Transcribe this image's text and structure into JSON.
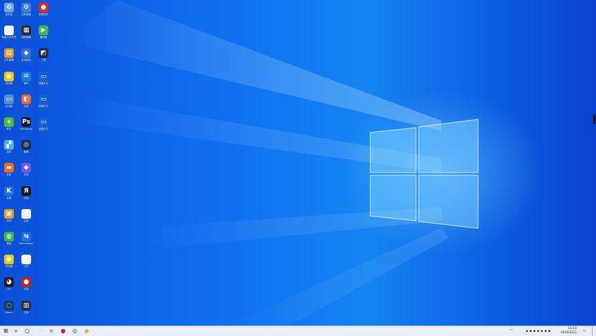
{
  "desktop": {
    "icons": [
      {
        "name": "recycle-bin-icon",
        "label": "回收站",
        "col": 0,
        "row": 0,
        "color": "#6aa8e8",
        "glyph": "♻"
      },
      {
        "name": "control-panel-icon",
        "label": "控制面板",
        "col": 1,
        "row": 0,
        "color": "#3d7fd6",
        "glyph": "⚙"
      },
      {
        "name": "record-app-icon",
        "label": "录屏软件",
        "col": 2,
        "row": 0,
        "color": "#d92a2a",
        "glyph": "●"
      },
      {
        "name": "document-icon",
        "label": "新建文本文档",
        "col": 0,
        "row": 1,
        "color": "#f4f4f4",
        "glyph": ""
      },
      {
        "name": "video-editor-icon",
        "label": "视频编辑",
        "col": 1,
        "row": 1,
        "color": "#2a2a2a",
        "glyph": "▦"
      },
      {
        "name": "player-icon",
        "label": "播放器",
        "col": 2,
        "row": 1,
        "color": "#3cb84a",
        "glyph": "▶"
      },
      {
        "name": "folder-app-icon",
        "label": "文件管理",
        "col": 0,
        "row": 2,
        "color": "#d99a2a",
        "glyph": "▤"
      },
      {
        "name": "store-icon",
        "label": "应用商店",
        "col": 1,
        "row": 2,
        "color": "#2b6fd6",
        "glyph": "◆"
      },
      {
        "name": "dark-app-icon",
        "label": "工具",
        "col": 2,
        "row": 2,
        "color": "#1d2a44",
        "glyph": "◩"
      },
      {
        "name": "browser-yellow-icon",
        "label": "浏览器",
        "col": 0,
        "row": 3,
        "color": "#e8c91a",
        "glyph": "◉"
      },
      {
        "name": "mail-icon",
        "label": "邮件",
        "col": 1,
        "row": 3,
        "color": "#1c7be0",
        "glyph": "✉"
      },
      {
        "name": "screen-shortcut-icon",
        "label": "快捷方式",
        "col": 2,
        "row": 3,
        "color": "#1261d9",
        "glyph": "▭"
      },
      {
        "name": "computer-icon",
        "label": "此电脑",
        "col": 0,
        "row": 4,
        "color": "#4a8fd9",
        "glyph": "▭"
      },
      {
        "name": "orange-app-icon",
        "label": "应用",
        "col": 1,
        "row": 4,
        "color": "#f0622a",
        "glyph": "◧"
      },
      {
        "name": "screen-shortcut-icon",
        "label": "快捷方式",
        "col": 2,
        "row": 4,
        "color": "#1261d9",
        "glyph": "▭"
      },
      {
        "name": "plus-app-icon",
        "label": "助手",
        "col": 0,
        "row": 5,
        "color": "#58b83a",
        "glyph": "+"
      },
      {
        "name": "photoshop-icon",
        "label": "Photoshop",
        "col": 1,
        "row": 5,
        "color": "#0b1b33",
        "glyph": "Ps"
      },
      {
        "name": "screen-shortcut-icon",
        "label": "快捷方式",
        "col": 2,
        "row": 5,
        "color": "#1261d9",
        "glyph": "▭"
      },
      {
        "name": "colorful-app-icon",
        "label": "应用",
        "col": 0,
        "row": 6,
        "color": "#4fb3e8",
        "glyph": "▞"
      },
      {
        "name": "screenshot-app-icon",
        "label": "截图",
        "col": 1,
        "row": 6,
        "color": "#1a2e55",
        "glyph": "◎"
      },
      {
        "name": "orange-badge-icon",
        "label": "应用",
        "col": 0,
        "row": 7,
        "color": "#f06a1a",
        "glyph": "▬"
      },
      {
        "name": "purple-app-icon",
        "label": "应用",
        "col": 1,
        "row": 7,
        "color": "#7a55e8",
        "glyph": "◆"
      },
      {
        "name": "k-app-icon",
        "label": "应用",
        "col": 0,
        "row": 8,
        "color": "#1d6fd8",
        "glyph": "K"
      },
      {
        "name": "red-logo-app-icon",
        "label": "应用",
        "col": 1,
        "row": 8,
        "color": "#1b1b1b",
        "glyph": "Я"
      },
      {
        "name": "game-app-icon",
        "label": "游戏",
        "col": 0,
        "row": 9,
        "color": "#e0a020",
        "glyph": "▣"
      },
      {
        "name": "red-arrow-app-icon",
        "label": "应用",
        "col": 1,
        "row": 9,
        "color": "#f2f2f2",
        "glyph": "❮"
      },
      {
        "name": "wechat-icon",
        "label": "微信",
        "col": 0,
        "row": 10,
        "color": "#3bb54a",
        "glyph": "◍"
      },
      {
        "name": "teamviewer-icon",
        "label": "TeamViewer",
        "col": 1,
        "row": 10,
        "color": "#1b74e0",
        "glyph": "⇆"
      },
      {
        "name": "browser-yellow-icon",
        "label": "浏览器",
        "col": 0,
        "row": 11,
        "color": "#e8c91a",
        "glyph": "◉"
      },
      {
        "name": "blank-file-icon",
        "label": "文件",
        "col": 1,
        "row": 11,
        "color": "#f7f7f7",
        "glyph": ""
      },
      {
        "name": "qq-icon",
        "label": "QQ",
        "col": 0,
        "row": 12,
        "color": "#1c1c1c",
        "glyph": "◕"
      },
      {
        "name": "red-circle-app-icon",
        "label": "应用",
        "col": 1,
        "row": 12,
        "color": "#c81e1e",
        "glyph": "●"
      },
      {
        "name": "steam-icon",
        "label": "Steam",
        "col": 0,
        "row": 13,
        "color": "#1a3a6a",
        "glyph": "◌"
      },
      {
        "name": "monitor-app-icon",
        "label": "应用",
        "col": 1,
        "row": 13,
        "color": "#2a2f3a",
        "glyph": "▥"
      }
    ]
  },
  "taskbar": {
    "start_glyph": "⊞",
    "search_glyph": "⌕",
    "taskview_glyph": "○",
    "pinned": [
      {
        "name": "edge-taskbar-icon",
        "glyph": "e",
        "color": "#1a7fd8"
      },
      {
        "name": "record-taskbar-icon",
        "glyph": "●",
        "color": "#c81e1e"
      },
      {
        "name": "screenshot-taskbar-icon",
        "glyph": "◎",
        "color": "#2060c0"
      },
      {
        "name": "browser-taskbar-icon",
        "glyph": "◉",
        "color": "#c8b010"
      }
    ],
    "tray_chevron": "^",
    "clock_time": "13:14",
    "clock_date": "2020/12/2"
  }
}
